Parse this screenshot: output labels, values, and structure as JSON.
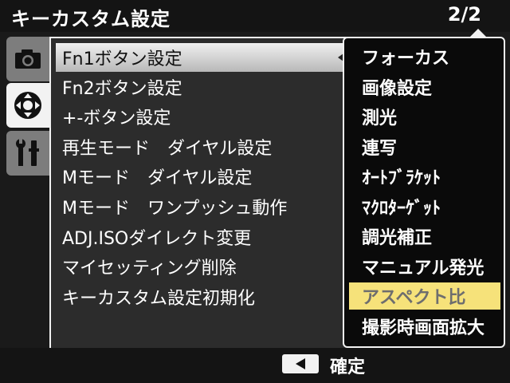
{
  "header": {
    "title": "キーカスタム設定",
    "page_indicator": "2/2"
  },
  "tabs": [
    {
      "icon": "camera-icon",
      "active": false
    },
    {
      "icon": "dpad-settings-icon",
      "active": true
    },
    {
      "icon": "wrench-settings-icon",
      "active": false
    }
  ],
  "menu": {
    "items": [
      {
        "label": "Fn1ボタン設定",
        "selected": true
      },
      {
        "label": "Fn2ボタン設定"
      },
      {
        "label": "+-ボタン設定"
      },
      {
        "label": "再生モード　ダイヤル設定"
      },
      {
        "label": "Mモード　ダイヤル設定"
      },
      {
        "label": "Mモード　ワンプッシュ動作"
      },
      {
        "label": "ADJ.ISOダイレクト変更"
      },
      {
        "label": "マイセッティング削除"
      },
      {
        "label": "キーカスタム設定初期化"
      }
    ]
  },
  "dropdown": {
    "options": [
      {
        "label": "フォーカス"
      },
      {
        "label": "画像設定"
      },
      {
        "label": "測光"
      },
      {
        "label": "連写"
      },
      {
        "label": "ｵｰﾄﾌﾞﾗｹｯﾄ"
      },
      {
        "label": "ﾏｸﾛﾀｰｹﾞｯﾄ"
      },
      {
        "label": "調光補正"
      },
      {
        "label": "マニュアル発光"
      },
      {
        "label": "アスペクト比",
        "state": "disabled-highlighted"
      },
      {
        "label": "撮影時画面拡大"
      }
    ]
  },
  "footer": {
    "confirm_label": "確定",
    "button_icon": "left-arrow-button-icon"
  },
  "colors": {
    "highlight": "#f6e27a",
    "disabled_text": "#6e6e6e",
    "selected_row": "#d8d8d8"
  }
}
